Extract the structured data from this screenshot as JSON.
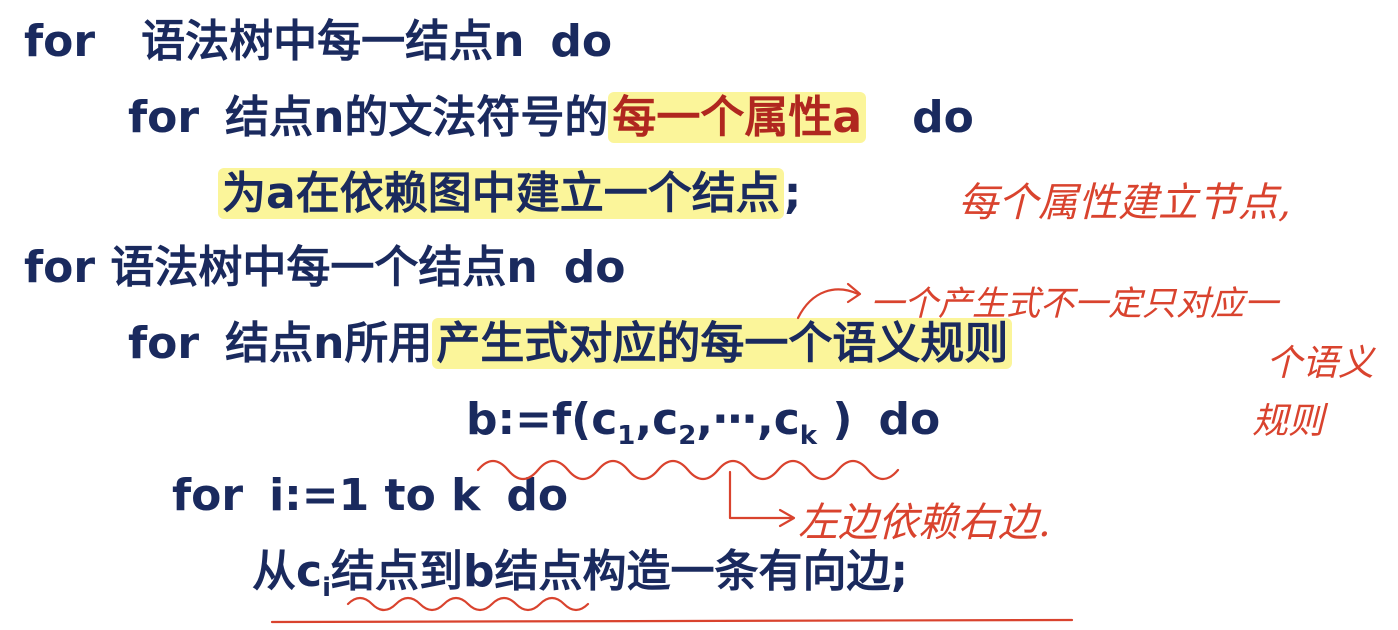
{
  "lines": {
    "l1": {
      "kw": "for",
      "text": "语法树中每一结点n",
      "kw2": "do"
    },
    "l2": {
      "kw": "for",
      "text": "结点n的文法符号的",
      "highlight": "每一个属性a",
      "kw2": "do"
    },
    "l3": {
      "highlight": "为a在依赖图中建立一个结点",
      "semi": ";"
    },
    "l4": {
      "kw": "for",
      "text": "语法树中每一个结点n",
      "kw2": "do"
    },
    "l5": {
      "kw": "for",
      "text": "结点n所用",
      "highlight": "产生式对应的每一个语义规则"
    },
    "l6": {
      "a": "b:=f(c",
      "s1": "1",
      "b": ",c",
      "s2": "2",
      "c": ",⋯,c",
      "sk": "k",
      "d": " )",
      "kw2": "do"
    },
    "l7": {
      "kw": "for",
      "text": "i:=1 to k",
      "kw2": "do"
    },
    "l8": {
      "a": "从c",
      "si": "i",
      "b": "结点到b结点构造一条有向边;"
    }
  },
  "annotations": {
    "a1": "每个属性建立节点,",
    "a2": "一个产生式不一定只对应一",
    "a3": "个语义",
    "a4": "规则",
    "a5": "左边依赖右边."
  },
  "colors": {
    "text": "#1a2a5e",
    "highlight": "#fbf59a",
    "red_text": "#b0271f",
    "ink": "#d9432e"
  }
}
